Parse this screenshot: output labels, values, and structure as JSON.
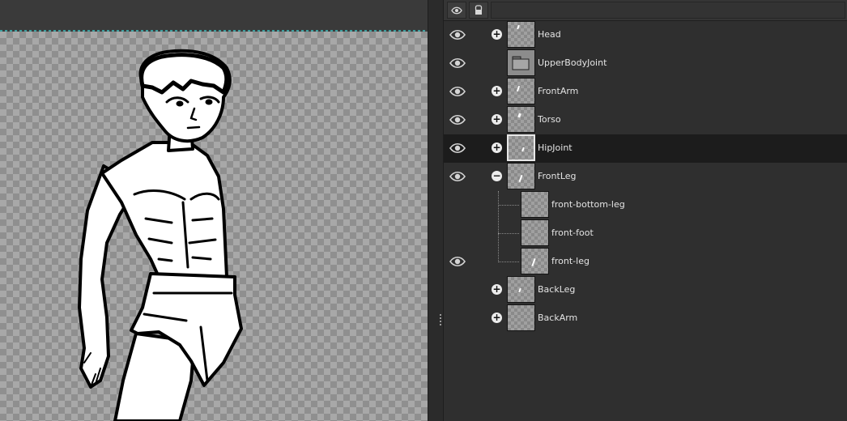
{
  "layers_panel": {
    "header": {
      "visibility_icon": "eye-icon",
      "lock_icon": "lock-icon"
    },
    "layers": [
      {
        "name": "Head",
        "visible": true,
        "expander": "+",
        "type": "bone",
        "indent": 0
      },
      {
        "name": "UpperBodyJoint",
        "visible": true,
        "expander": "",
        "type": "folder",
        "indent": 0
      },
      {
        "name": "FrontArm",
        "visible": true,
        "expander": "+",
        "type": "bone",
        "indent": 0
      },
      {
        "name": "Torso",
        "visible": true,
        "expander": "+",
        "type": "bone",
        "indent": 0
      },
      {
        "name": "HipJoint",
        "visible": true,
        "expander": "+",
        "type": "bone",
        "indent": 0,
        "selected": true
      },
      {
        "name": "FrontLeg",
        "visible": true,
        "expander": "−",
        "type": "bone",
        "indent": 0
      },
      {
        "name": "front-bottom-leg",
        "visible": false,
        "expander": "",
        "type": "image",
        "indent": 1
      },
      {
        "name": "front-foot",
        "visible": false,
        "expander": "",
        "type": "image",
        "indent": 1
      },
      {
        "name": "front-leg",
        "visible": true,
        "expander": "",
        "type": "image",
        "indent": 1
      },
      {
        "name": "BackLeg",
        "visible": false,
        "expander": "+",
        "type": "bone",
        "indent": 0
      },
      {
        "name": "BackArm",
        "visible": false,
        "expander": "+",
        "type": "bone",
        "indent": 0
      }
    ]
  },
  "colors": {
    "panel_bg": "#2f2f2f",
    "selected_row": "#1c1c1c",
    "text": "#e4e4e4",
    "canvas_guide": "#3fa0a0"
  }
}
